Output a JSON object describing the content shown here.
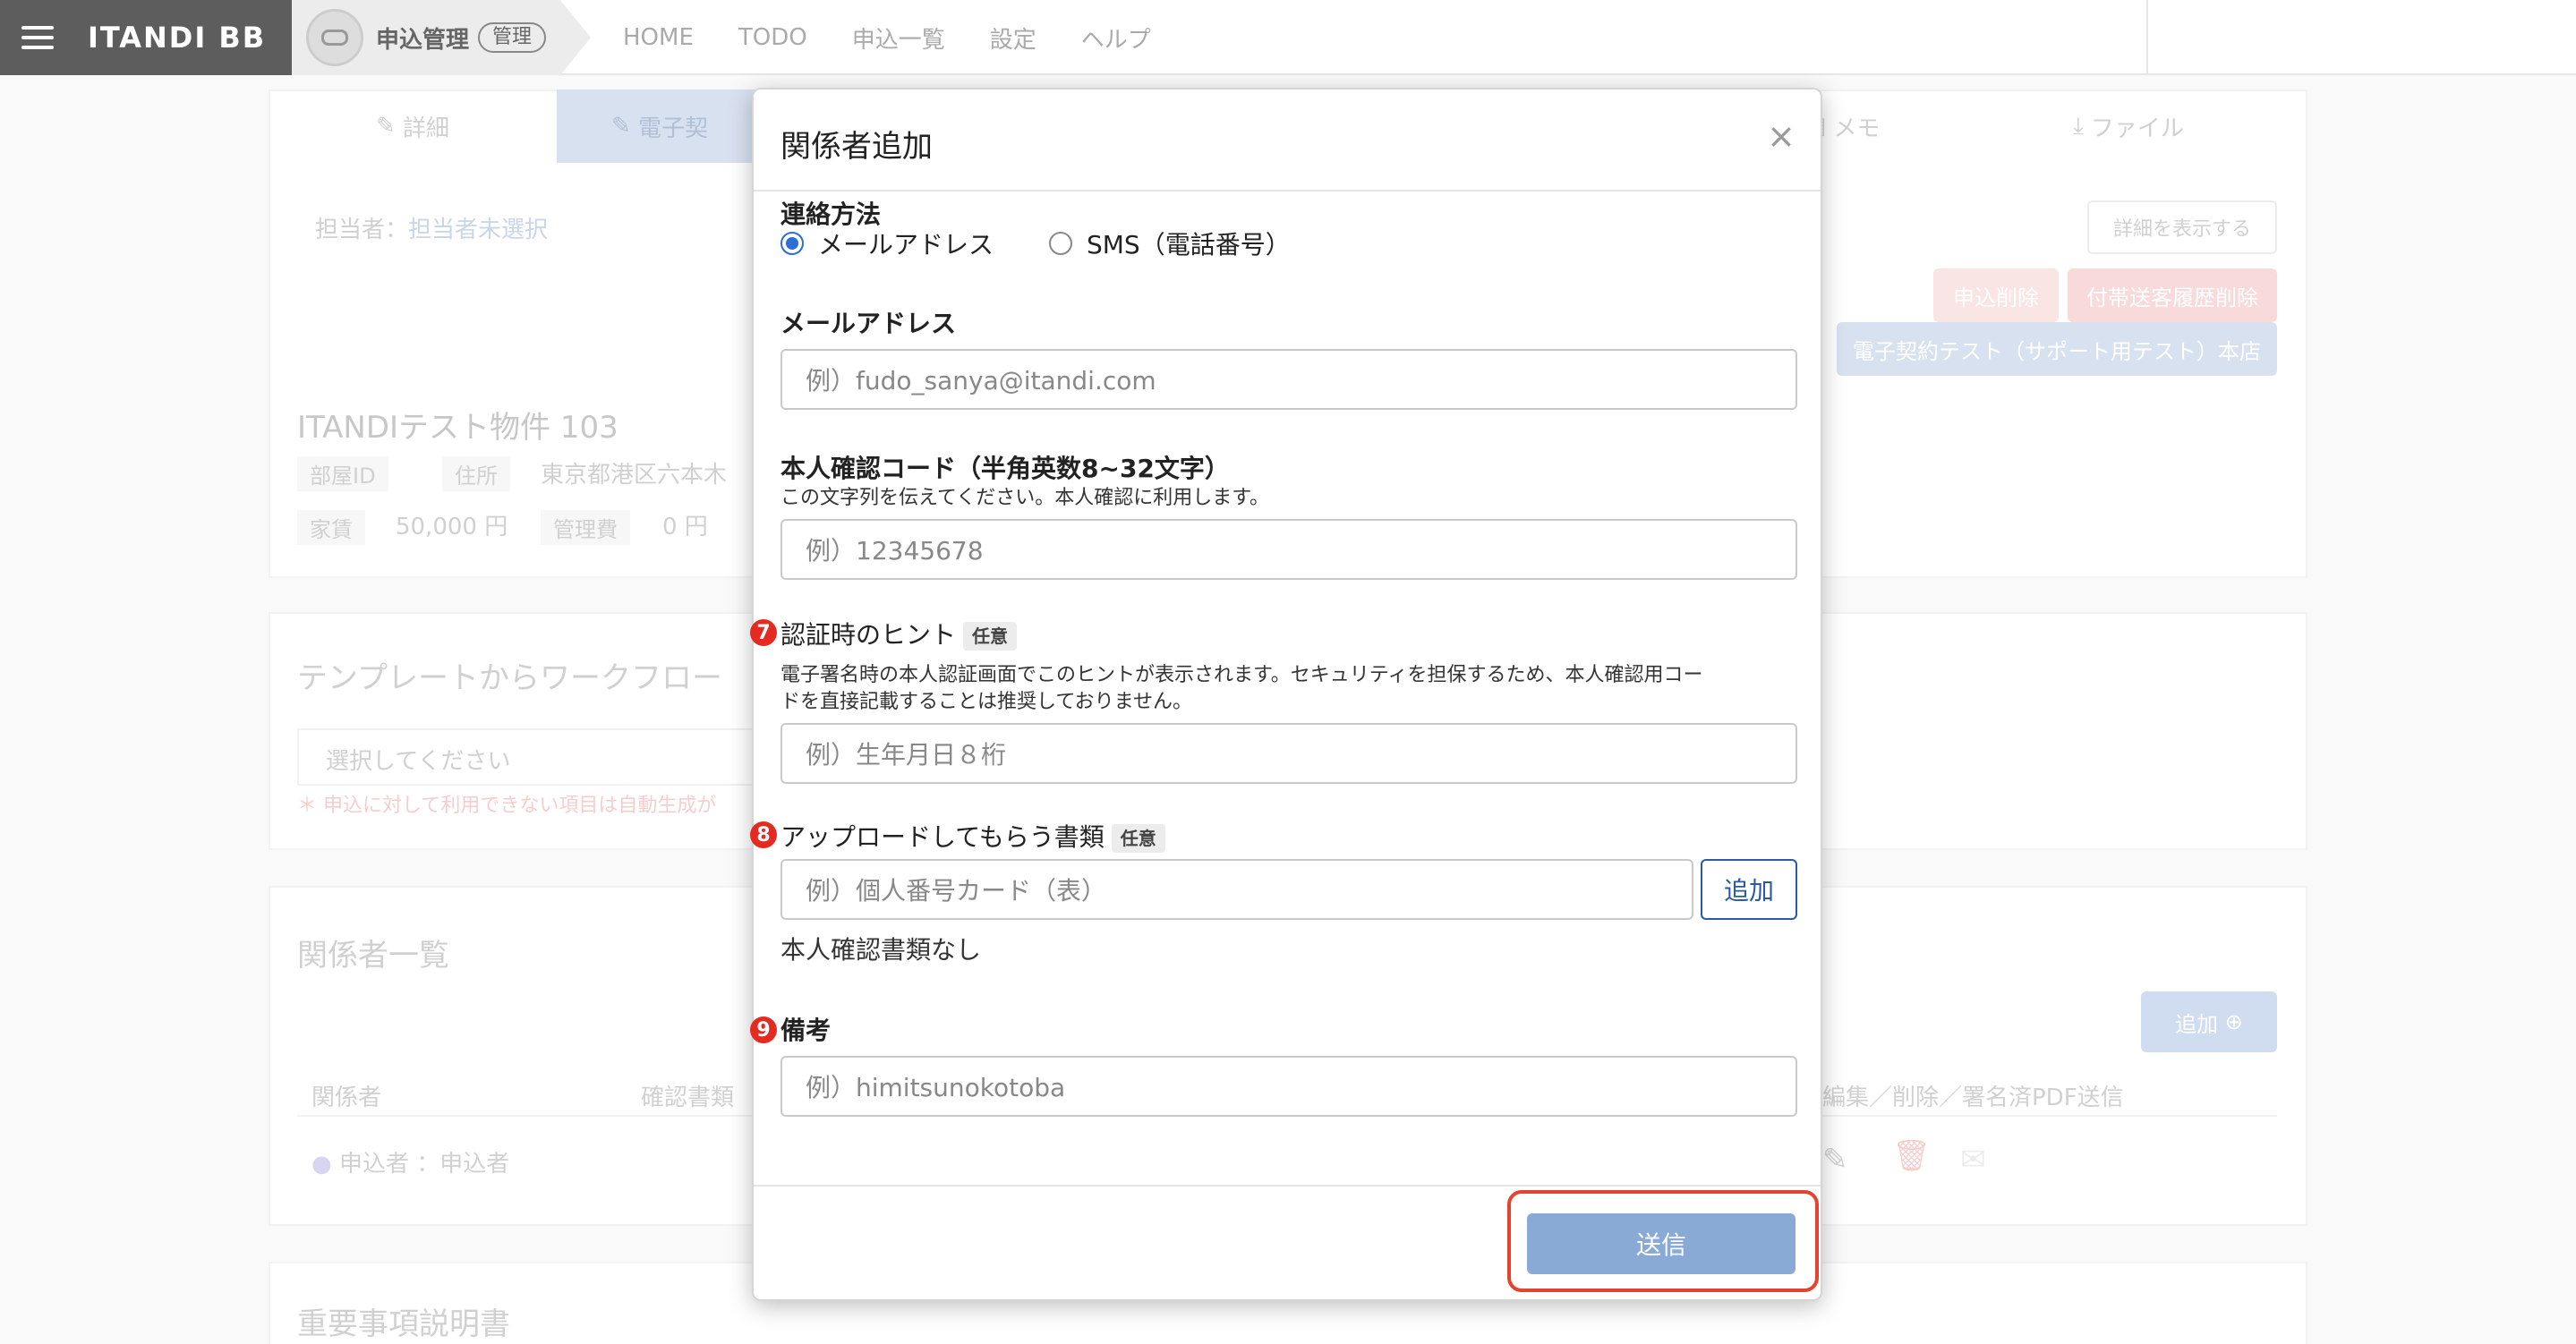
{
  "topbar": {
    "brand": "ITANDI BB",
    "app_name": "申込管理",
    "app_badge": "管理",
    "nav": [
      "HOME",
      "TODO",
      "申込一覧",
      "設定",
      "ヘルプ"
    ]
  },
  "background": {
    "tabs": [
      "詳細",
      "電子契",
      "メモ",
      "ファイル"
    ],
    "assignee_label": "担当者：",
    "assignee_value": "担当者未選択",
    "show_detail": "詳細を表示する",
    "delete_app": "申込削除",
    "delete_history": "付帯送客履歴削除",
    "store_button": "電子契約テスト（サポート用テスト）本店",
    "property_title": "ITANDIテスト物件 103",
    "room_id_label": "部屋ID",
    "address_label": "住所",
    "address_value": "東京都港区六本木",
    "rent_label": "家賃",
    "rent_value": "50,000 円",
    "fee_label": "管理費",
    "fee_value": "0 円",
    "template_heading": "テンプレートからワークフロー",
    "select_placeholder": "選択してください",
    "template_note": "＊ 申込に対して利用できない項目は自動生成が",
    "parties_heading": "関係者一覧",
    "add_button": "追加",
    "col_party": "関係者",
    "col_docs": "確認書類",
    "col_actions": "編集／削除／署名済PDF送信",
    "party_row": "申込者 ：申込者",
    "important_heading": "重要事項説明書"
  },
  "modal": {
    "title": "関係者追加",
    "close": "×",
    "contact_label": "連絡方法",
    "contact_options": [
      "メールアドレス",
      "SMS（電話番号）"
    ],
    "email_label": "メールアドレス",
    "email_placeholder": "例）fudo_sanya@itandi.com",
    "code_label": "本人確認コード（半角英数8~32文字）",
    "code_help": "この文字列を伝えてください。本人確認に利用します。",
    "code_placeholder": "例）12345678",
    "hint_number": "7",
    "hint_label": "認証時のヒント",
    "optional_tag": "任意",
    "hint_help_1": "電子署名時の本人認証画面でこのヒントが表示されます。セキュリティを担保するため、本人確認用コー",
    "hint_help_2": "ドを直接記載することは推奨しておりません。",
    "hint_placeholder": "例）生年月日８桁",
    "upload_number": "8",
    "upload_label": "アップロードしてもらう書類",
    "upload_placeholder": "例）個人番号カード（表）",
    "upload_add": "追加",
    "upload_none": "本人確認書類なし",
    "note_number": "9",
    "note_label": "備考",
    "note_placeholder": "例）himitsunokotoba",
    "submit": "送信"
  },
  "colors": {
    "primary": "#2b6fd6",
    "submit_bg": "#8aaad6",
    "highlight": "#e3442f",
    "step_badge": "#e42b22"
  }
}
